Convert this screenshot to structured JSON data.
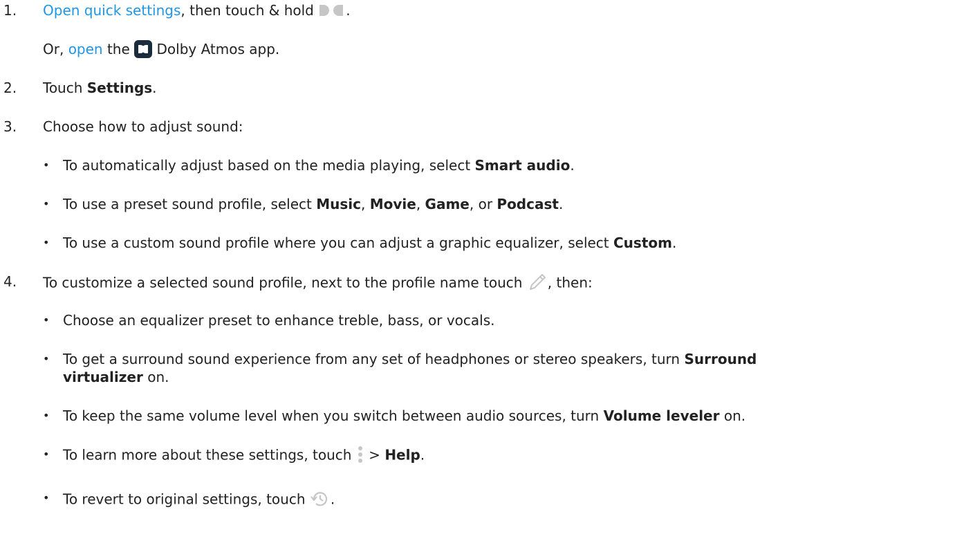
{
  "colors": {
    "link": "#1f96e8",
    "text": "#222222",
    "icon_gray": "#c6c6c6",
    "app_icon_bg": "#1a2b3c"
  },
  "steps": [
    {
      "num": "1.",
      "link": "Open quick settings",
      "pre": ", then touch & hold ",
      "post": ".",
      "alt": {
        "pre": "Or, ",
        "link": "open",
        "mid": " the ",
        "post": " Dolby Atmos app."
      }
    },
    {
      "num": "2.",
      "pre": "Touch ",
      "bold": "Settings",
      "post": "."
    },
    {
      "num": "3.",
      "text": "Choose how to adjust sound:",
      "bullets": [
        {
          "pre": "To automatically adjust based on the media playing, select ",
          "bold": "Smart audio",
          "post": "."
        },
        {
          "pre": "To use a preset sound profile, select ",
          "b1": "Music",
          "s1": ", ",
          "b2": "Movie",
          "s2": ", ",
          "b3": "Game",
          "s3": ", or ",
          "b4": "Podcast",
          "post": "."
        },
        {
          "pre": "To use a custom sound profile where you can adjust a graphic equalizer, select ",
          "bold": "Custom",
          "post": "."
        }
      ]
    },
    {
      "num": "4.",
      "pre": "To customize a selected sound profile, next to the profile name touch ",
      "post": ", then:",
      "bullets": [
        {
          "text": "Choose an equalizer preset to enhance treble, bass, or vocals."
        },
        {
          "pre": "To get a surround sound experience from any set of headphones or stereo speakers, turn ",
          "bold": "Surround",
          "bold2": "virtualizer",
          "post": " on."
        },
        {
          "pre": "To keep the same volume level when you switch between audio sources, turn ",
          "bold": "Volume leveler",
          "post": " on."
        },
        {
          "pre": "To learn more about these settings, touch ",
          "mid": " > ",
          "bold": "Help",
          "post": "."
        },
        {
          "pre": "To revert to original settings, touch ",
          "post": "."
        }
      ]
    }
  ],
  "bullet_char": "•",
  "icons": {
    "dolby_quick_tile": "dolby-quick-settings-icon",
    "dolby_app": "dolby-atmos-app-icon",
    "edit": "pencil-edit-icon",
    "menu": "more-vert-icon",
    "revert": "history-revert-icon"
  }
}
